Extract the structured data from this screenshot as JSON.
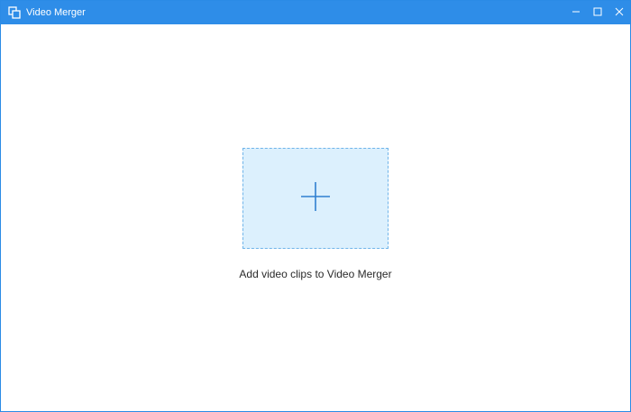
{
  "window": {
    "title": "Video Merger",
    "app_icon": "video-merger-app-icon",
    "accent_color": "#2e8de8",
    "controls": {
      "minimize_icon": "minimize-icon",
      "maximize_icon": "maximize-icon",
      "close_icon": "close-icon"
    }
  },
  "main": {
    "dropzone": {
      "icon": "plus-icon",
      "background_color": "#dcf0fd",
      "border_color": "#6fb4ea",
      "plus_color": "#2f7fd0"
    },
    "hint_text": "Add video clips to Video Merger"
  }
}
